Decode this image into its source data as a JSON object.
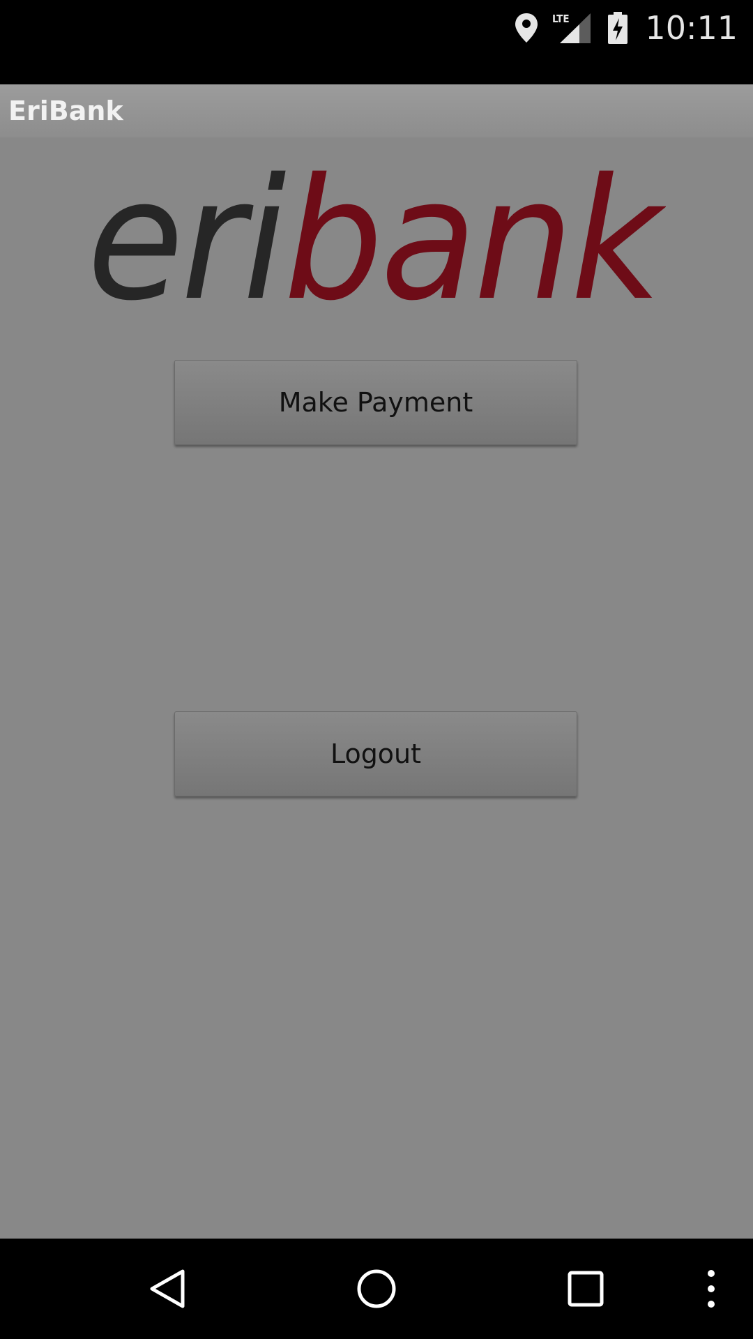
{
  "status_bar": {
    "time": "10:11",
    "network_label": "LTE",
    "icons": [
      "location-icon",
      "lte-signal-icon",
      "battery-charging-icon"
    ]
  },
  "action_bar": {
    "title": "EriBank"
  },
  "logo": {
    "text_dark": "eri",
    "text_red": "bank",
    "colors": {
      "dark": "#262626",
      "red": "#6e0c17"
    }
  },
  "buttons": {
    "make_payment": "Make Payment",
    "logout": "Logout"
  },
  "nav_bar": {
    "icons": [
      "back-icon",
      "home-icon",
      "recents-icon",
      "overflow-menu-icon"
    ]
  }
}
